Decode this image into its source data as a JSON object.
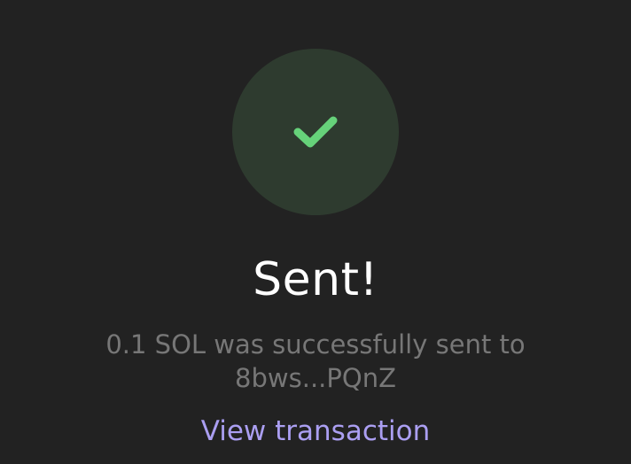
{
  "icons": {
    "success": "checkmark-icon"
  },
  "status": {
    "title": "Sent!",
    "message_line1": "0.1 SOL was successfully sent to",
    "message_line2": "8bws...PQnZ",
    "link_label": "View transaction"
  },
  "colors": {
    "background": "#222222",
    "success_circle": "#2e3b2f",
    "checkmark": "#66d27a",
    "title": "#ffffff",
    "message": "#777777",
    "link": "#ab9ff2"
  }
}
